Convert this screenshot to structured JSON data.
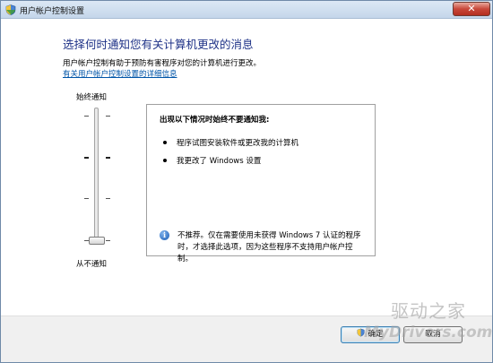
{
  "window": {
    "title": "用户帐户控制设置",
    "close_label": "✕"
  },
  "main": {
    "heading": "选择何时通知您有关计算机更改的消息",
    "description": "用户帐户控制有助于预防有害程序对您的计算机进行更改。",
    "link": "有关用户帐户控制设置的详细信息"
  },
  "slider": {
    "top_label": "始终通知",
    "bottom_label": "从不通知",
    "levels": 4,
    "selected_level": 1
  },
  "infobox": {
    "title": "出现以下情况时始终不要通知我:",
    "bullets": [
      "程序试图安装软件或更改我的计算机",
      "我更改了 Windows 设置"
    ],
    "note": "不推荐。仅在需要使用未获得 Windows 7 认证的程序时，才选择此选项，因为这些程序不支持用户帐户控制。"
  },
  "footer": {
    "ok_label": "确定",
    "cancel_label": "取消"
  },
  "watermark": {
    "cjk": "驱动之家",
    "latin": "MyDrivers.com"
  },
  "colors": {
    "heading": "#1e3287",
    "link": "#0055a8",
    "footer_bg": "#f0f0f0"
  }
}
